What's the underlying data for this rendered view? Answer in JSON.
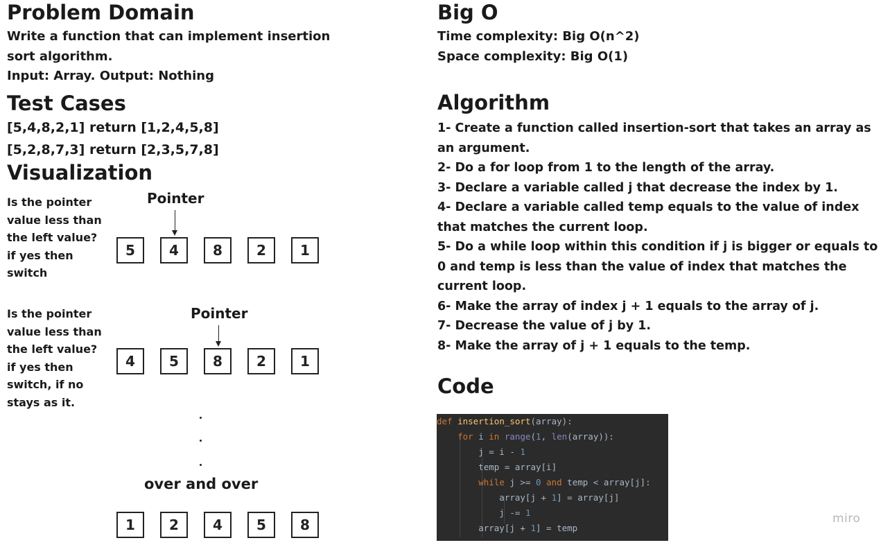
{
  "problem_domain": {
    "title": "Problem Domain",
    "line1": "Write a function that can implement insertion",
    "line2": "sort algorithm.",
    "line3": "Input: Array. Output: Nothing"
  },
  "test_cases": {
    "title": "Test Cases",
    "case1": "[5,4,8,2,1] return [1,2,4,5,8]",
    "case2": "[5,2,8,7,3] return [2,3,5,7,8]"
  },
  "visualization": {
    "title": "Visualization",
    "step1": {
      "lines": [
        "Is the pointer",
        "value less than",
        "the left value?",
        "if yes then",
        "switch"
      ],
      "pointer_label": "Pointer",
      "values": [
        "5",
        "4",
        "8",
        "2",
        "1"
      ]
    },
    "step2": {
      "lines": [
        "Is the pointer",
        "value less than",
        "the left value?",
        "if yes then",
        "switch, if no",
        "stays as it."
      ],
      "pointer_label": "Pointer",
      "values": [
        "4",
        "5",
        "8",
        "2",
        "1"
      ]
    },
    "repeat_label": "over and over",
    "final_values": [
      "1",
      "2",
      "4",
      "5",
      "8"
    ]
  },
  "big_o": {
    "title": "Big O",
    "time": "Time complexity: Big O(n^2)",
    "space": "Space complexity: Big O(1)"
  },
  "algorithm": {
    "title": "Algorithm",
    "lines": [
      "1- Create a function called insertion-sort that takes an array as",
      "an argument.",
      "2- Do a for loop from 1 to the length of the array.",
      "3- Declare a variable called j that decrease the index by 1.",
      "4- Declare a variable called temp equals to the value of index",
      "that matches the current loop.",
      "5- Do a while loop within this condition if j is bigger or equals to",
      "0 and temp is less than the value of index that matches the",
      "current loop.",
      "6- Make the array of index j + 1 equals to the array of j.",
      "7- Decrease the value of j by 1.",
      "8- Make the array of j + 1 equals to the temp."
    ]
  },
  "code": {
    "title": "Code",
    "lines": [
      "def insertion_sort(array):",
      "    for i in range(1, len(array)):",
      "        j = i - 1",
      "        temp = array[i]",
      "        while j >= 0 and temp < array[j]:",
      "            array[j + 1] = array[j]",
      "            j -= 1",
      "        array[j + 1] = temp"
    ]
  },
  "watermark": "miro"
}
